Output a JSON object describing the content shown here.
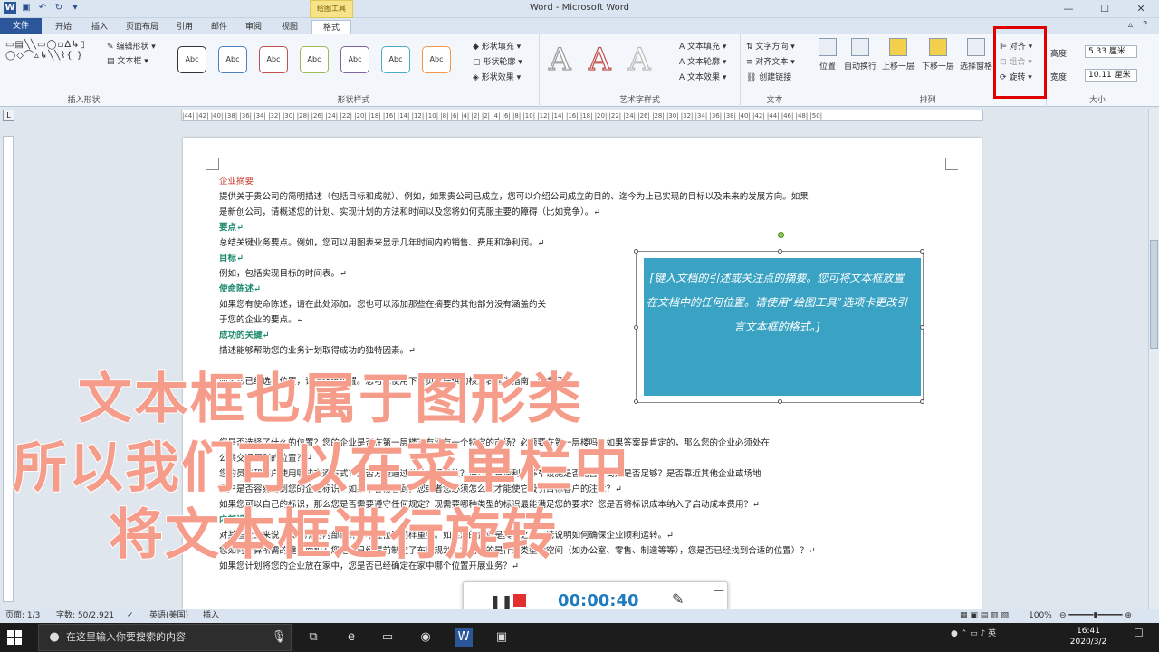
{
  "window": {
    "title": "Word - Microsoft Word",
    "minimize": "—",
    "maximize": "☐",
    "close": "✕"
  },
  "contextual_header": "绘图工具",
  "tabs": [
    {
      "label": "文件"
    },
    {
      "label": "开始"
    },
    {
      "label": "插入"
    },
    {
      "label": "页面布局"
    },
    {
      "label": "引用"
    },
    {
      "label": "邮件"
    },
    {
      "label": "审阅"
    },
    {
      "label": "视图"
    },
    {
      "label": "格式"
    }
  ],
  "ribbon": {
    "insert_shapes": {
      "label": "插入形状",
      "edit_shape": "编辑形状",
      "draw_textbox": "文本框"
    },
    "shape_styles": {
      "label": "形状样式",
      "fill": "形状填充",
      "outline": "形状轮廓",
      "effects": "形状效果",
      "presets": [
        {
          "text": "Abc",
          "color": "#333333"
        },
        {
          "text": "Abc",
          "color": "#4f81bd"
        },
        {
          "text": "Abc",
          "color": "#c0504d"
        },
        {
          "text": "Abc",
          "color": "#9bbb59"
        },
        {
          "text": "Abc",
          "color": "#8064a2"
        },
        {
          "text": "Abc",
          "color": "#4bacc6"
        },
        {
          "text": "Abc",
          "color": "#f79646"
        }
      ]
    },
    "wordart": {
      "label": "艺术字样式",
      "text_fill": "文本填充",
      "text_outline": "文本轮廓",
      "text_effects": "文本效果",
      "samples": [
        "A",
        "A",
        "A"
      ]
    },
    "text": {
      "label": "文本",
      "direction": "文字方向",
      "align": "对齐文本",
      "link": "创建链接"
    },
    "arrange": {
      "label": "排列",
      "position": "位置",
      "wrap": "自动换行",
      "bring_forward": "上移一层",
      "send_backward": "下移一层",
      "selection_pane": "选择窗格",
      "align": "对齐",
      "group": "组合",
      "rotate": "旋转"
    },
    "size": {
      "label": "大小",
      "height_label": "高度:",
      "height_value": "5.33 厘米",
      "width_label": "宽度:",
      "width_value": "10.11 厘米"
    }
  },
  "ruler": {
    "marks": "|44| |42| |40| |38| |36| |34| |32| |30| |28| |26| |24| |22| |20| |18| |16| |14| |12| |10| |8| |6| |4| |2| |2| |4| |6| |8| |10| |12| |14| |16| |18| |20| |22| |24| |26| |28| |30| |32| |34| |36| |38| |40| |42| |44| |46| |48| |50|"
  },
  "document": {
    "lines": [
      {
        "text": "企业摘要",
        "style": "red"
      },
      {
        "text": "提供关于贵公司的简明描述（包括目标和成就）。例如，如果贵公司已成立，您可以介绍公司成立的目的、迄今为止已实现的目标以及未来的发展方向。如果",
        "style": ""
      },
      {
        "text": "是新创公司，请概述您的计划、实现计划的方法和时间以及您将如何克服主要的障碍（比如竞争）。↵",
        "style": ""
      },
      {
        "text": "要点↵",
        "style": "h"
      },
      {
        "text": "总结关键业务要点。例如，您可以用图表来显示几年时间内的销售、费用和净利润。↵",
        "style": ""
      },
      {
        "text": "目标↵",
        "style": "h"
      },
      {
        "text": "例如，包括实现目标的时间表。↵",
        "style": ""
      },
      {
        "text": "使命陈述↵",
        "style": "h"
      },
      {
        "text": "如果您有使命陈述，请在此处添加。您也可以添加那些在摘要的其他部分没有涵盖的关",
        "style": ""
      },
      {
        "text": "于您的企业的要点。↵",
        "style": ""
      },
      {
        "text": "成功的关键↵",
        "style": "h"
      },
      {
        "text": "描述能够帮助您的业务计划取得成功的独特因素。↵",
        "style": ""
      },
      {
        "text": "",
        "style": ""
      },
      {
        "text": "如果您已经选择位置，请描述该位置。您可以使用下一页中提供的核对表作为指南，或者开",
        "style": ""
      },
      {
        "text": "",
        "style": ""
      },
      {
        "text": "",
        "style": ""
      },
      {
        "text": "",
        "style": ""
      },
      {
        "text": "您是否选择了什么的位置？您的企业是否在第一层楼？有没有一个特定的市场？必须要在第一层楼吗？如果答案是肯定的，那么您的企业必须处在",
        "style": ""
      },
      {
        "text": "公共交通便利的位置？↵",
        "style": ""
      },
      {
        "text": "    您的员工和客户使用哪些交通方式？是否方便通过公共交通前往？通过是否便利？停车设施是否完善？街灯是否足够？是否靠近其他企业或场地",
        "style": ""
      },
      {
        "text": "    客户是否容易看到您的企业标识？如果不容易看到，您或者您必须怎么做才能使它吸引目标客户的注意？↵",
        "style": ""
      },
      {
        "text": "    如果您可以自己的标识，那么您是否需要遵守任何规定？现需要哪种类型的标识最能满足您的要求？您是否将标识成本纳入了启动成本费用？↵",
        "style": ""
      },
      {
        "text": "内部设计↵",
        "style": "h"
      },
      {
        "text": "对某些企业来说，其场所的内部设计与地理位置同样重要。如果您的企业是其中之一，请说明如何确保企业顺利运转。↵",
        "style": ""
      },
      {
        "text": "您如何计算所需的建筑面积？您是否已经提前制定了布局规划？您需要的是什么类型的空间（如办公室、零售、制造等等），您是否已经找到合适的位置）？↵",
        "style": ""
      },
      {
        "text": "如果您计划将您的企业放在家中，您是否已经确定在家中哪个位置开展业务？↵",
        "style": ""
      }
    ],
    "textbox_text": "[键入文档的引述或关注点的摘要。您可将文本框放置在文档中的任何位置。请使用“绘图工具”选项卡更改引言文本框的格式。]"
  },
  "captions": [
    "文本框也属于图形类",
    "所以我们可以在菜单栏中",
    "将文本框进行旋转"
  ],
  "recorder": {
    "time": "00:00:40"
  },
  "statusbar": {
    "page": "页面: 1/3",
    "words": "字数: 50/2,921",
    "language": "英语(美国)",
    "mode": "插入",
    "zoom": "100%"
  },
  "taskbar": {
    "search_placeholder": "在这里输入你要搜索的内容",
    "time": "16:41",
    "date": "2020/3/2"
  }
}
